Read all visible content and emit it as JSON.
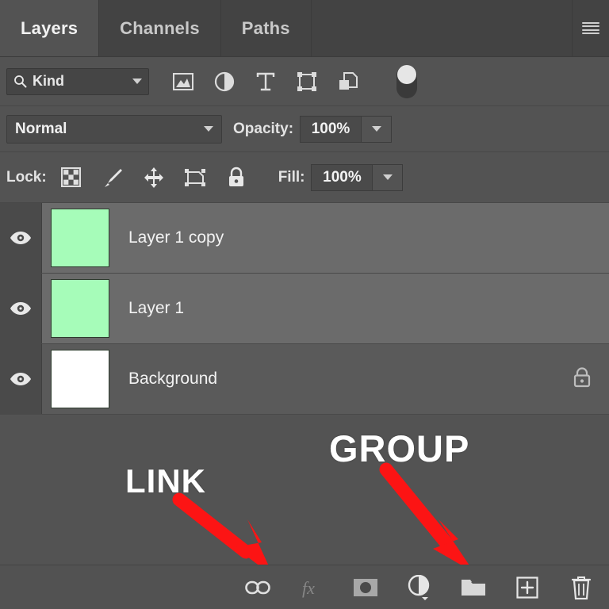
{
  "panel": {
    "tabs": [
      {
        "label": "Layers",
        "active": true
      },
      {
        "label": "Channels",
        "active": false
      },
      {
        "label": "Paths",
        "active": false
      }
    ],
    "menu_icon": "hamburger-menu-icon"
  },
  "filter": {
    "kind_label": "Kind",
    "search_icon": "search-icon",
    "icons": [
      "filter-pixel-layers-icon",
      "filter-adjustment-layers-icon",
      "filter-type-layers-icon",
      "filter-shape-layers-icon",
      "filter-smart-object-layers-icon",
      "filter-toggle-switch"
    ]
  },
  "blend": {
    "mode": "Normal",
    "opacity_label": "Opacity:",
    "opacity_value": "100%"
  },
  "lock": {
    "label": "Lock:",
    "icons": [
      "lock-transparent-pixels-icon",
      "lock-image-pixels-icon",
      "lock-position-icon",
      "lock-artboard-nesting-icon",
      "lock-all-icon"
    ],
    "fill_label": "Fill:",
    "fill_value": "100%"
  },
  "layers": [
    {
      "name": "Layer 1 copy",
      "visible": true,
      "selected": true,
      "thumb_color": "#a6fcb9",
      "locked": false
    },
    {
      "name": "Layer 1",
      "visible": true,
      "selected": true,
      "thumb_color": "#a6fcb9",
      "locked": false
    },
    {
      "name": "Background",
      "visible": true,
      "selected": false,
      "thumb_color": "#ffffff",
      "locked": true
    }
  ],
  "annotations": [
    {
      "text": "LINK",
      "color": "#fc1414",
      "points_to": "link-layers-button"
    },
    {
      "text": "GROUP",
      "color": "#fc1414",
      "points_to": "new-group-button"
    }
  ],
  "bottom_toolbar": [
    {
      "name": "link-layers-button",
      "icon": "chain-link-icon",
      "disabled": false
    },
    {
      "name": "layer-style-button",
      "icon": "fx-icon",
      "disabled": true
    },
    {
      "name": "layer-mask-button",
      "icon": "mask-icon",
      "disabled": false
    },
    {
      "name": "new-fill-adjustment-button",
      "icon": "half-circle-icon",
      "disabled": false
    },
    {
      "name": "new-group-button",
      "icon": "folder-icon",
      "disabled": false
    },
    {
      "name": "new-layer-button",
      "icon": "plus-square-icon",
      "disabled": false
    },
    {
      "name": "delete-layer-button",
      "icon": "trash-icon",
      "disabled": false
    }
  ],
  "colors": {
    "panel_bg": "#535353",
    "tab_inactive_bg": "#434343",
    "row_selected": "#6b6b6b",
    "row_normal": "#5a5a5a",
    "eye_column": "#4a4a4a",
    "annotation_red": "#fc1414",
    "layer_green": "#a6fcb9"
  }
}
